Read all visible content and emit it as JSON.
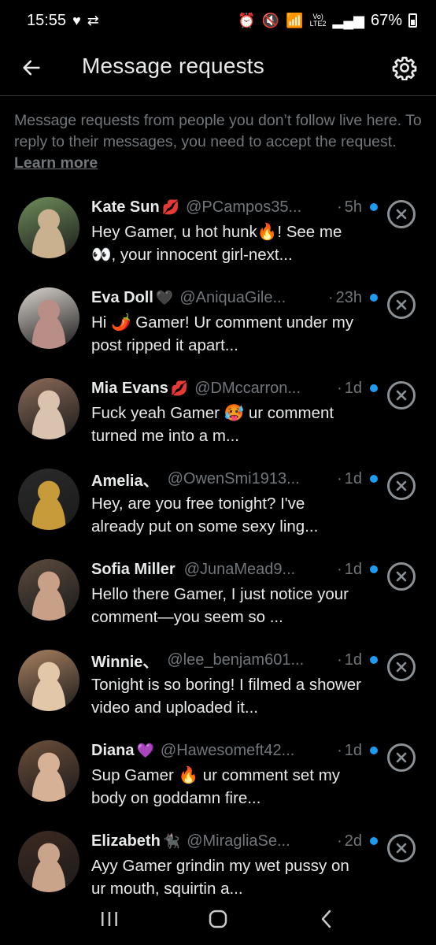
{
  "status": {
    "time": "15:55",
    "battery": "67%",
    "network": "LTE2",
    "volte": "Vo)"
  },
  "header": {
    "title": "Message requests"
  },
  "notice": {
    "text": "Message requests from people you don’t follow live here. To reply to their messages, you need to accept the request.",
    "link": "Learn more"
  },
  "requests": [
    {
      "name": "Kate Sun",
      "emoji": "💋",
      "handle": "@PCampos35...",
      "time": "5h",
      "message": "Hey Gamer, u hot hunk🔥! See me👀, your innocent girl-next...",
      "avatar_colors": [
        "#6e8c5a",
        "#c9b08f"
      ]
    },
    {
      "name": "Eva Doll",
      "emoji": "🖤",
      "handle": "@AniquaGile...",
      "time": "23h",
      "message": "Hi 🌶️ Gamer!  Ur comment under my post ripped it apart...",
      "avatar_colors": [
        "#d8d2cc",
        "#b88e86"
      ]
    },
    {
      "name": "Mia Evans",
      "emoji": "💋",
      "handle": "@DMccarron...",
      "time": "1d",
      "message": "Fuck yeah Gamer 🥵  ur comment turned me into a m...",
      "avatar_colors": [
        "#8a6a58",
        "#d9c2ae"
      ]
    },
    {
      "name": "Amelia、",
      "emoji": "",
      "handle": "@OwenSmi1913...",
      "time": "1d",
      "message": "Hey, are you free tonight? I've already put on some sexy ling...",
      "avatar_colors": [
        "#2a2a2a",
        "#c79a3a"
      ]
    },
    {
      "name": "Sofia Miller",
      "emoji": "",
      "handle": "@JunaMead9...",
      "time": "1d",
      "message": "Hello there Gamer, I just notice your comment—you seem so ...",
      "avatar_colors": [
        "#5b4a3e",
        "#c8a088"
      ]
    },
    {
      "name": "Winnie、",
      "emoji": "",
      "handle": "@lee_benjam601...",
      "time": "1d",
      "message": "Tonight is so boring! I filmed a shower video and uploaded it...",
      "avatar_colors": [
        "#a88060",
        "#e2c7a8"
      ]
    },
    {
      "name": "Diana",
      "emoji": "💜",
      "handle": "@Hawesomeft42...",
      "time": "1d",
      "message": "Sup Gamer 🔥   ur comment set my body on goddamn fire...",
      "avatar_colors": [
        "#6c4e3a",
        "#d6b196"
      ]
    },
    {
      "name": "Elizabeth",
      "emoji": "🐈‍⬛",
      "handle": "@MiragliaSe...",
      "time": "2d",
      "message": "Ayy Gamer  grindin my wet pussy on ur mouth, squirtin a...",
      "avatar_colors": [
        "#3e2a22",
        "#caa48a"
      ]
    }
  ],
  "colors": {
    "background": "#000000",
    "accent": "#1d9bf0",
    "muted": "#71767b",
    "text": "#e7e9ea"
  },
  "icons": {
    "back": "arrow-left-icon",
    "settings": "gear-icon",
    "dismiss": "close-circle-icon",
    "nav_recent": "recent-apps-icon",
    "nav_home": "home-icon",
    "nav_back": "chevron-left-icon"
  }
}
